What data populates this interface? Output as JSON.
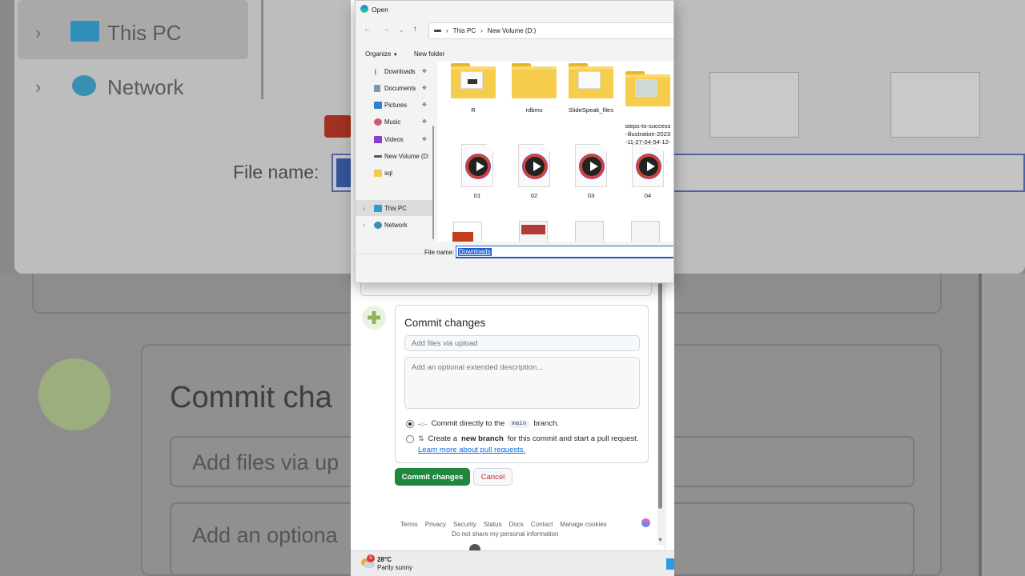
{
  "background": {
    "nav_this_pc": "This PC",
    "nav_network": "Network",
    "file_name_label": "File name:",
    "commit_heading": "Commit cha",
    "input_summary": "Add files via up",
    "input_desc": "Add an optiona"
  },
  "dialog": {
    "title": "Open",
    "breadcrumb": [
      "This PC",
      "New Volume (D:)"
    ],
    "toolbar": {
      "organize": "Organize",
      "new_folder": "New folder"
    },
    "tree": [
      {
        "label": "Downloads",
        "icon": "download-icon",
        "pinned": true
      },
      {
        "label": "Documents",
        "icon": "documents-icon",
        "pinned": true
      },
      {
        "label": "Pictures",
        "icon": "pictures-icon",
        "pinned": true
      },
      {
        "label": "Music",
        "icon": "music-icon",
        "pinned": true
      },
      {
        "label": "Videos",
        "icon": "videos-icon",
        "pinned": true
      },
      {
        "label": "New Volume (D:",
        "icon": "drive-icon",
        "pinned": false
      },
      {
        "label": "sql",
        "icon": "folder-icon",
        "pinned": false
      },
      {
        "label": "This PC",
        "icon": "this-pc-icon",
        "selected": true
      },
      {
        "label": "Network",
        "icon": "network-icon"
      }
    ],
    "folders": [
      "R",
      "rdbms",
      "SlideSpeak_files",
      "steps-to-success\n-illustration-2023\n-11-27-04-54-12-\nutc"
    ],
    "videos": [
      "01",
      "02",
      "03",
      "04"
    ],
    "file_name_label": "File name:",
    "file_name_value": "Downloads"
  },
  "commit": {
    "title": "Commit changes",
    "summary_placeholder": "Add files via upload",
    "description_placeholder": "Add an optional extended description...",
    "option_direct_prefix": "Commit directly to the",
    "branch": "main",
    "option_direct_suffix": "branch.",
    "option_new_prefix": "Create a",
    "option_new_bold": "new branch",
    "option_new_suffix": "for this commit and start a pull request.",
    "learn_more": "Learn more about pull requests.",
    "commit_button": "Commit changes",
    "cancel_button": "Cancel"
  },
  "footer": {
    "links": [
      "Terms",
      "Privacy",
      "Security",
      "Status",
      "Docs",
      "Contact",
      "Manage cookies"
    ],
    "privacy_notice": "Do not share my personal information"
  },
  "taskbar": {
    "weather_badge": "5",
    "temperature": "28°C",
    "condition": "Partly sunny"
  },
  "colors": {
    "commit_green": "#1f883d",
    "link_blue": "#0969da",
    "cancel_red": "#cf222e",
    "selection_blue": "#1f5fc9"
  }
}
